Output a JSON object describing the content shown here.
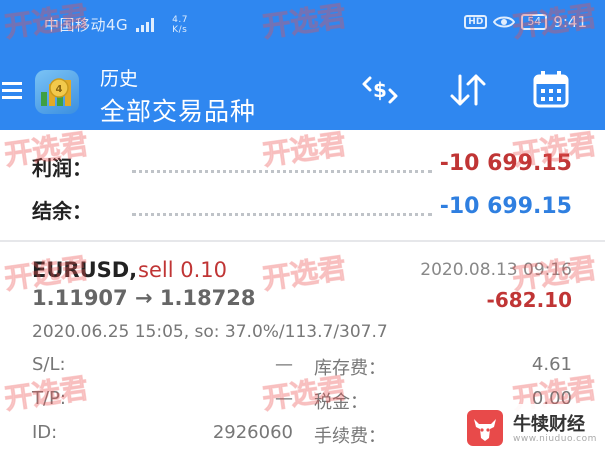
{
  "status_bar": {
    "carrier": "中国移动4G",
    "speed_value": "4.7",
    "speed_unit": "K/s",
    "battery": "54",
    "time": "9:41"
  },
  "app_bar": {
    "title": "历史",
    "subtitle": "全部交易品种",
    "accent_color": "#2f87f0",
    "icons": [
      "menu-icon",
      "currency-switch-icon",
      "sort-icon",
      "calendar-icon"
    ]
  },
  "summary": {
    "profit_label": "利润：",
    "profit_value": "-10 699.15",
    "balance_label": "结余：",
    "balance_value": "-10 699.15"
  },
  "trade": {
    "symbol": "EURUSD,",
    "type": "sell 0.10",
    "close_time": "2020.08.13 09:16",
    "prices": "1.11907 → 1.18728",
    "profit": "-682.10",
    "open_info": "2020.06.25 15:05, so: 37.0%/113.7/307.7",
    "sl_label": "S/L:",
    "sl_value": "—",
    "tp_label": "T/P:",
    "tp_value": "—",
    "id_label": "ID:",
    "id_value": "2926060",
    "swap_label": "库存费：",
    "swap_value": "4.61",
    "tax_label": "税金：",
    "tax_value": "0.00",
    "commission_label": "手续费："
  },
  "watermark_text": "开选君",
  "brand": {
    "name": "牛犊财经",
    "url": "www.niuduo.com"
  },
  "colors": {
    "negative": "#c03535",
    "balance": "#2f7fe0"
  }
}
